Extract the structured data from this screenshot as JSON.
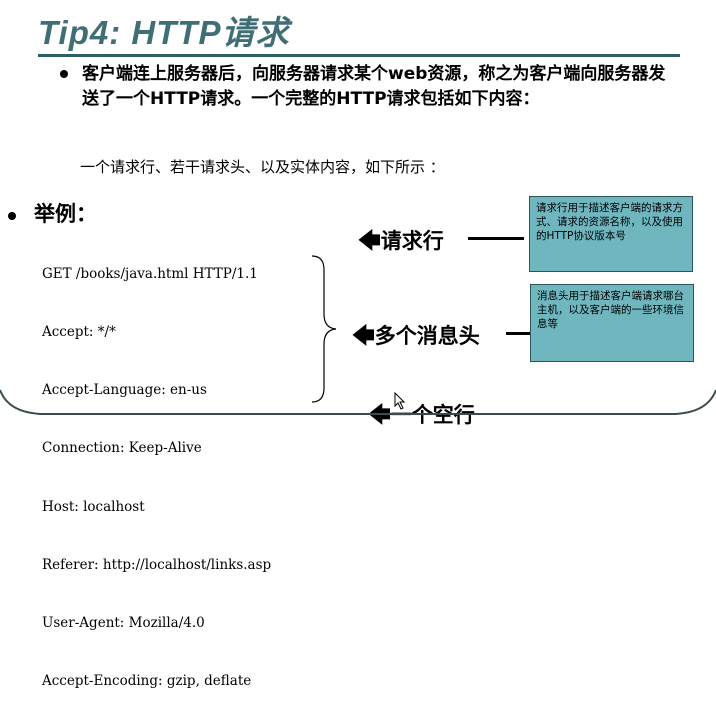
{
  "slide": {
    "title": "Tip4: HTTP请求",
    "paragraph": "客户端连上服务器后，向服务器请求某个web资源，称之为客户端向服务器发送了一个HTTP请求。一个完整的HTTP请求包括如下内容：",
    "subtext": "一个请求行、若干请求头、以及实体内容，如下所示 ：",
    "example_heading": "举例：",
    "code_lines": [
      "GET /books/java.html HTTP/1.1",
      "Accept: */*",
      "Accept-Language: en-us",
      "Connection: Keep-Alive",
      "Host: localhost",
      "Referer: http://localhost/links.asp",
      "User-Agent: Mozilla/4.0",
      "Accept-Encoding: gzip, deflate"
    ],
    "label_request_line": "请求行",
    "label_headers": "多个消息头",
    "label_blank_line": "一个空行",
    "box_request_line": "请求行用于描述客户端的请求方式、请求的资源名称，以及使用的HTTP协议版本号",
    "box_headers": "消息头用于描述客户端请求哪台主机，以及客户端的一些环境信息等"
  },
  "colors": {
    "title": "#3f6f75",
    "rule": "#2f5f66",
    "box_fill": "#6fb6bf"
  }
}
